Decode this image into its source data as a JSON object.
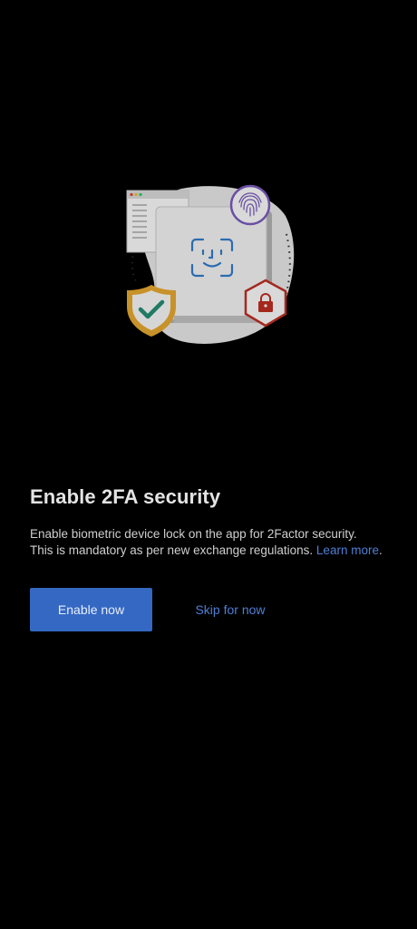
{
  "illustration": {
    "icons": [
      "browser-window-icon",
      "face-id-icon",
      "fingerprint-icon",
      "shield-check-icon",
      "padlock-hexagon-icon"
    ]
  },
  "content": {
    "title": "Enable 2FA security",
    "description_line1": "Enable biometric device lock on the app for 2Factor security.",
    "description_line2": "This is mandatory as per new exchange regulations. ",
    "learn_more_label": "Learn more",
    "period": "."
  },
  "actions": {
    "primary_label": "Enable now",
    "secondary_label": "Skip for now"
  },
  "colors": {
    "background": "#000000",
    "accent": "#3468c2",
    "link": "#4f7fd6",
    "shield": "#c8922a",
    "check": "#1f7a64",
    "lock": "#a5281e",
    "fingerprint": "#6a4fa3"
  }
}
